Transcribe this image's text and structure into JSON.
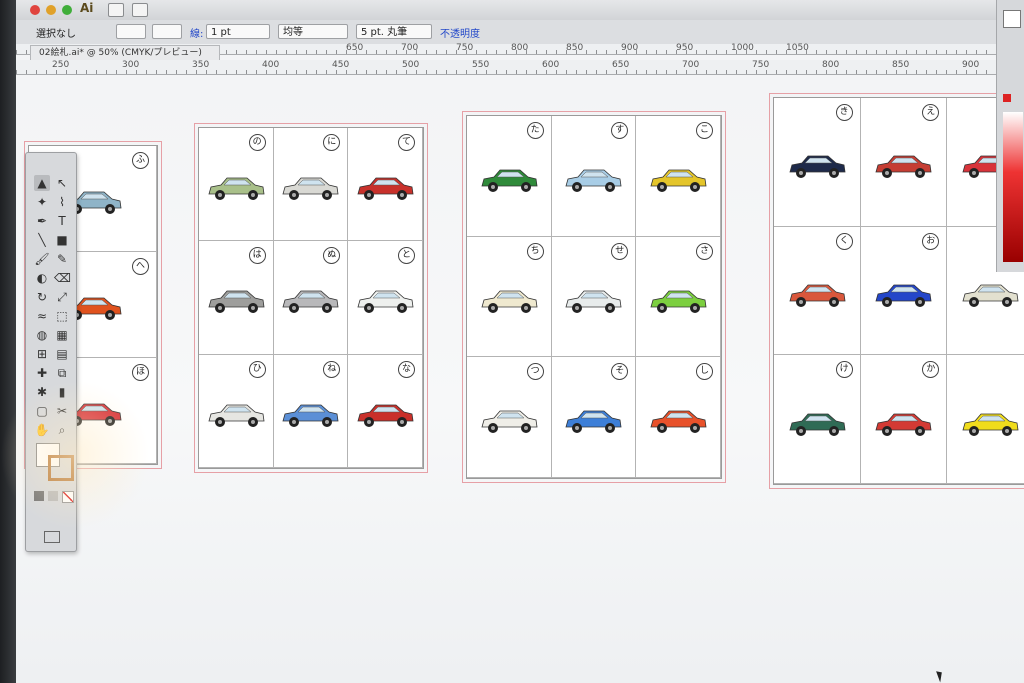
{
  "app": {
    "logo": "Ai",
    "document_tab": "02絵札.ai* @ 50% (CMYK/プレビュー)"
  },
  "controlbar": {
    "selection": "選択なし",
    "stroke_label": "線:",
    "stroke_weight": "1 pt",
    "stroke_profile": "均等",
    "brush": "5 pt. 丸筆",
    "opacity_label": "不透明度"
  },
  "ruler": {
    "top_numbers": [
      "650",
      "700",
      "750",
      "800",
      "850",
      "900",
      "950",
      "1000",
      "1050"
    ],
    "doc_numbers": [
      "250",
      "300",
      "350",
      "400",
      "450",
      "500",
      "550",
      "600",
      "650",
      "700",
      "750",
      "800",
      "850",
      "900"
    ]
  },
  "pages": [
    {
      "kana": [
        "ふ",
        "へ",
        "ほ"
      ],
      "cars": [
        {
          "color": "#8fb4c8"
        },
        {
          "color": "#e0521e"
        },
        {
          "color": "#d8333a"
        }
      ]
    },
    {
      "kana": [
        "の",
        "に",
        "て",
        "は",
        "ぬ",
        "と",
        "ひ",
        "ね",
        "な"
      ],
      "cars": [
        {
          "color": "#a9c08a"
        },
        {
          "color": "#d9d9d4"
        },
        {
          "color": "#c8312b"
        },
        {
          "color": "#9e9e9c"
        },
        {
          "color": "#b8b8ba"
        },
        {
          "color": "#eef0ee"
        },
        {
          "color": "#e6e6e2"
        },
        {
          "color": "#5b8fd6"
        },
        {
          "color": "#c9302a"
        }
      ]
    },
    {
      "kana": [
        "た",
        "す",
        "こ",
        "ち",
        "せ",
        "さ",
        "つ",
        "そ",
        "し"
      ],
      "cars": [
        {
          "color": "#2f8a3a"
        },
        {
          "color": "#a8cde6"
        },
        {
          "color": "#e4c52a"
        },
        {
          "color": "#efe9cf"
        },
        {
          "color": "#e8ecec"
        },
        {
          "color": "#7ccf3f"
        },
        {
          "color": "#efeee8"
        },
        {
          "color": "#3d7fd8"
        },
        {
          "color": "#e8512a"
        }
      ]
    },
    {
      "kana": [
        "き",
        "え",
        "",
        "く",
        "お",
        "",
        "け",
        "か",
        ""
      ],
      "cars": [
        {
          "color": "#1e2a4a"
        },
        {
          "color": "#c53d33"
        },
        {
          "color": "#d8333a"
        },
        {
          "color": "#d9573c"
        },
        {
          "color": "#2446c9"
        },
        {
          "color": "#e2e0cf"
        },
        {
          "color": "#2f6b55"
        },
        {
          "color": "#d33a34"
        },
        {
          "color": "#f0dc1c"
        }
      ]
    }
  ],
  "toolbox": {
    "tools": [
      "selection-tool",
      "direct-selection-tool",
      "magic-wand-tool",
      "lasso-tool",
      "pen-tool",
      "type-tool",
      "line-tool",
      "rectangle-tool",
      "paintbrush-tool",
      "pencil-tool",
      "blob-brush-tool",
      "eraser-tool",
      "rotate-tool",
      "scale-tool",
      "width-tool",
      "free-transform-tool",
      "shape-builder-tool",
      "perspective-tool",
      "mesh-tool",
      "gradient-tool",
      "eyedropper-tool",
      "blend-tool",
      "symbol-sprayer-tool",
      "graph-tool",
      "artboard-tool",
      "slice-tool",
      "hand-tool",
      "zoom-tool"
    ]
  },
  "colors": {
    "page_bleed": "#e6a0a6",
    "grid_line": "#b3b3b3",
    "accent_blue": "#2348c9"
  }
}
